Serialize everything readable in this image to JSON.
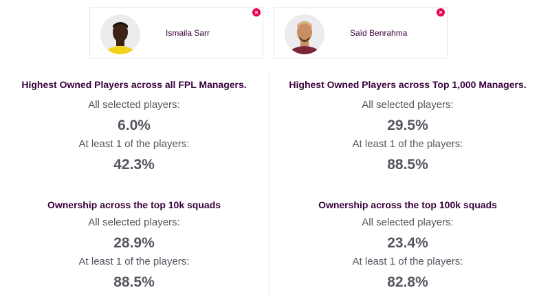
{
  "players": [
    {
      "name": "Ismaila Sarr",
      "remove_label": "×",
      "shirt_color": "#f2d21c",
      "skin_color": "#3b2417",
      "hair_color": "#1e130c"
    },
    {
      "name": "Saïd Benrahma",
      "remove_label": "×",
      "shirt_color": "#7a2636",
      "skin_color": "#c98e63",
      "hair_color": "#d8b58a"
    }
  ],
  "stats": [
    {
      "title": "Highest Owned Players across all FPL Managers.",
      "all_label": "All selected players:",
      "all_value": "6.0%",
      "any_label": "At least 1 of the players:",
      "any_value": "42.3%"
    },
    {
      "title": "Highest Owned Players across Top 1,000 Managers.",
      "all_label": "All selected players:",
      "all_value": "29.5%",
      "any_label": "At least 1 of the players:",
      "any_value": "88.5%"
    },
    {
      "title": "Ownership across the top 10k squads",
      "all_label": "All selected players:",
      "all_value": "28.9%",
      "any_label": "At least 1 of the players:",
      "any_value": "88.5%"
    },
    {
      "title": "Ownership across the top 100k squads",
      "all_label": "All selected players:",
      "all_value": "23.4%",
      "any_label": "At least 1 of the players:",
      "any_value": "82.8%"
    }
  ],
  "colors": {
    "accent": "#e90052",
    "title": "#37003c",
    "text": "#555560"
  }
}
